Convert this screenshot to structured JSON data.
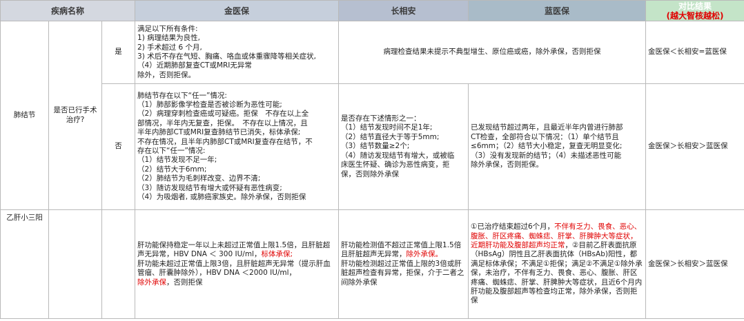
{
  "headers": {
    "disease": "疾病名称",
    "jin": "金医保",
    "chang": "长相安",
    "lan": "蓝医保",
    "compare_line1": "对比结果",
    "compare_line2": "(越大智核越松)"
  },
  "lung": {
    "disease": "肺结节",
    "question": "是否已行手术治疗?",
    "yes": {
      "label": "是",
      "jin_lines": [
        "满足以下所有条件:",
        "1) 病理结果为良性,",
        "2) 手术超过 6 个月,",
        "3) 术后不存在气短、胸痛、咯血或体重骤降等相关症状,",
        "（4）近期肺部复查CT或MRI无异常",
        "除外，否则拒保。"
      ],
      "chang_lan": "病理检查结果未提示不典型增生、原位癌或癌，除外承保，否则拒保",
      "compare": "金医保＜长相安=蓝医保"
    },
    "no": {
      "label": "否",
      "jin_lines": [
        "肺结节存在以下“任一”情况:",
        "（1）肺部影像学检查是否被诊断为恶性可能;",
        "（2）病理穿刺检查癌或可疑癌。拒保　不存在以上全",
        "部情况，半年内无复查，拒保。　不存在以上情况，且",
        "半年内肺部CT或MRI复查肺结节已消失，标体承保;",
        "不存在情况，且半年内肺部CT或MRI复查存在结节，不",
        "存在以下“任一”情况:",
        "（1）结节发现不足一年;",
        "（2）结节大于6mm;",
        "（2）肺结节为毛刺样改变、边界不清;",
        "（3）随访发现结节有增大或怀疑有恶性病变;",
        "（4）为吸烟者, 或肺癌家族史。除外承保，否则拒保"
      ],
      "chang_lines": [
        "是否存在下述情形之一：",
        "（1）结节发现时间不足1年;",
        "（2）结节直径大于等于5mm;",
        "（3）结节数量≥2个;",
        "（4）随访发现结节有增大，或被临",
        "床医生怀疑、确诊为恶性病变，拒",
        "保，否则除外承保"
      ],
      "lan_lines": [
        "已发现结节超过两年，且最近半年内曾进行肺部",
        "CT检查，全部符合以下情况：（1）单个结节且",
        "≤6mm；（2）结节大小稳定，复查无明显变化;",
        "（3）没有发现新的结节；（4）未描述恶性可能",
        "除外承保，否则拒保。"
      ],
      "compare": "金医保＞长相安＞蓝医保"
    }
  },
  "hep": {
    "disease": "乙肝小三阳",
    "jin": {
      "p1": "肝功能保持稳定一年以上未超过正常值上限1.5倍，且肝脏超声无异常，HBV DNA ＜ 300 IU/ml，",
      "p1_red": "标体承保;",
      "p2": "肝功能未超过正常值上限3倍，且肝脏超声无异常（提示肝血管瘤、肝囊肿除外），HBV DNA ＜2000 IU/ml，",
      "p2_red": "除外承保",
      "p3": "，否则拒保"
    },
    "chang": {
      "p1": "肝功能检测值不超过正常值上限1.5倍且肝脏超声无异常，",
      "p1_red": "除外承保。",
      "p2": "肝功能检测超过正常值上限的3倍或肝脏超声检查有异常，拒保，介于二者之间除外承保"
    },
    "lan": {
      "p1": "①已治疗结束超过6个月，",
      "p1_red": "不伴有乏力、畏食、恶心、腹胀、肝区疼痛、蜘蛛痣、肝掌、肝脾肿大等症状，近期肝功能及腹部超声均正常",
      "p2": "，②目前乙肝表面抗原（HBsAg）阴性且乙肝表面抗体（HBsAb)阳性，都满足标体承保；不满足①拒保；满足②不满足①除外承保，未治疗，不伴有乏力、畏食、恶心、腹胀、肝区疼痛、蜘蛛痣、肝掌、肝脾肿大等症状，且近6个月内肝功能及腹部超声等检查均正常，除外承保，否则拒保"
    },
    "compare": "金医保＞长相安＞蓝医保"
  }
}
